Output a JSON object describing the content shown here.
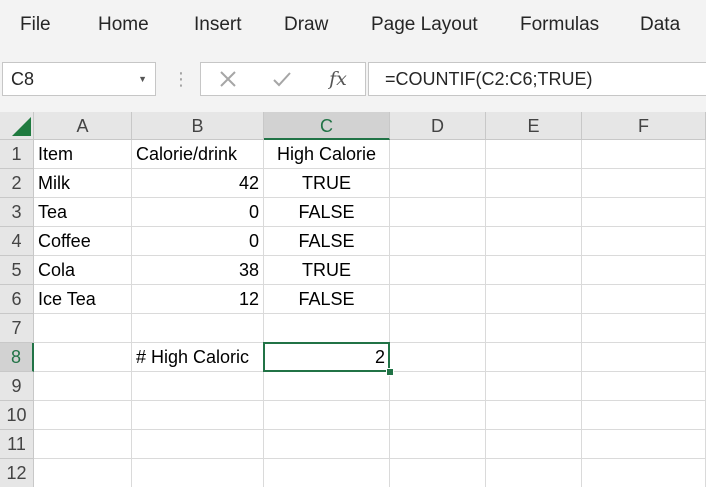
{
  "ribbon": {
    "tabs": [
      "File",
      "Home",
      "Insert",
      "Draw",
      "Page Layout",
      "Formulas",
      "Data"
    ]
  },
  "name_box": {
    "value": "C8",
    "arrow_icon": "dropdown-arrow-icon"
  },
  "formula_bar": {
    "cancel_icon": "cancel-icon",
    "enter_icon": "checkmark-icon",
    "fx_label": "fx",
    "formula": "=COUNTIF(C2:C6;TRUE)"
  },
  "sheet": {
    "columns": [
      "A",
      "B",
      "C",
      "D",
      "E",
      "F"
    ],
    "rows": [
      "1",
      "2",
      "3",
      "4",
      "5",
      "6",
      "7",
      "8",
      "9",
      "10",
      "11",
      "12"
    ],
    "selected_cell": "C8",
    "cells": {
      "A1": "Item",
      "B1": "Calorie/drink",
      "C1": "High Calorie",
      "A2": "Milk",
      "B2": "42",
      "C2": "TRUE",
      "A3": "Tea",
      "B3": "0",
      "C3": "FALSE",
      "A4": "Coffee",
      "B4": "0",
      "C4": "FALSE",
      "A5": "Cola",
      "B5": "38",
      "C5": "TRUE",
      "A6": "Ice Tea",
      "B6": "12",
      "C6": "FALSE",
      "B8": "# High Caloric",
      "C8": "2"
    }
  },
  "colors": {
    "accent": "#217346",
    "ribbon_bg": "#f3f3f3",
    "header_bg": "#e6e6e6"
  }
}
